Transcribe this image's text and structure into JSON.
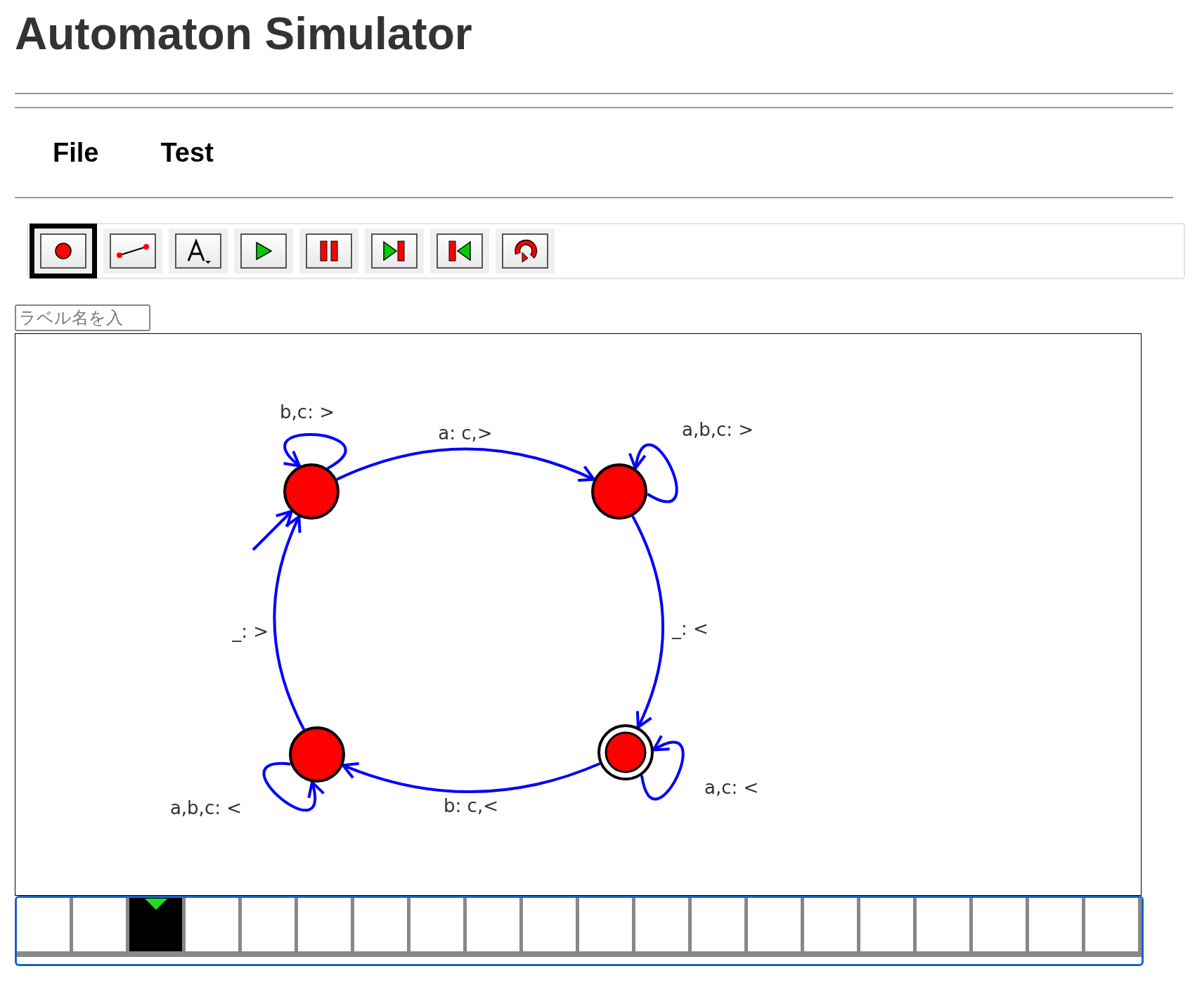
{
  "title": "Automaton Simulator",
  "menu": [
    {
      "label": "File"
    },
    {
      "label": "Test"
    }
  ],
  "toolbar": [
    {
      "kind": "state",
      "selected": true
    },
    {
      "kind": "transition",
      "selected": false
    },
    {
      "kind": "label",
      "selected": false
    },
    {
      "kind": "play",
      "selected": false
    },
    {
      "kind": "pause",
      "selected": false
    },
    {
      "kind": "step-forward",
      "selected": false
    },
    {
      "kind": "step-back",
      "selected": false
    },
    {
      "kind": "reset",
      "selected": false
    }
  ],
  "label_field": {
    "placeholder": "ラベル名を入"
  },
  "diagram": {
    "states": [
      {
        "initial": true,
        "accepting": false
      },
      {
        "initial": false,
        "accepting": false
      },
      {
        "initial": false,
        "accepting": false
      },
      {
        "initial": false,
        "accepting": true
      }
    ],
    "transitions": [
      {
        "kind": "loop",
        "label": "b,c: >"
      },
      {
        "kind": "edge",
        "label": "a: c,>"
      },
      {
        "kind": "loop",
        "label": "a,b,c: >"
      },
      {
        "kind": "edge",
        "label": "_: >"
      },
      {
        "kind": "edge",
        "label": "_: <"
      },
      {
        "kind": "loop",
        "label": "a,b,c: <"
      },
      {
        "kind": "edge",
        "label": "b: c,<"
      },
      {
        "kind": "loop",
        "label": "a,c: <"
      }
    ]
  },
  "tape": {
    "cells": [
      {
        "head": false
      },
      {
        "head": false
      },
      {
        "head": true
      },
      {
        "head": false
      },
      {
        "head": false
      },
      {
        "head": false
      },
      {
        "head": false
      },
      {
        "head": false
      },
      {
        "head": false
      },
      {
        "head": false
      },
      {
        "head": false
      },
      {
        "head": false
      },
      {
        "head": false
      },
      {
        "head": false
      },
      {
        "head": false
      },
      {
        "head": false
      },
      {
        "head": false
      },
      {
        "head": false
      },
      {
        "head": false
      },
      {
        "head": false
      }
    ]
  }
}
